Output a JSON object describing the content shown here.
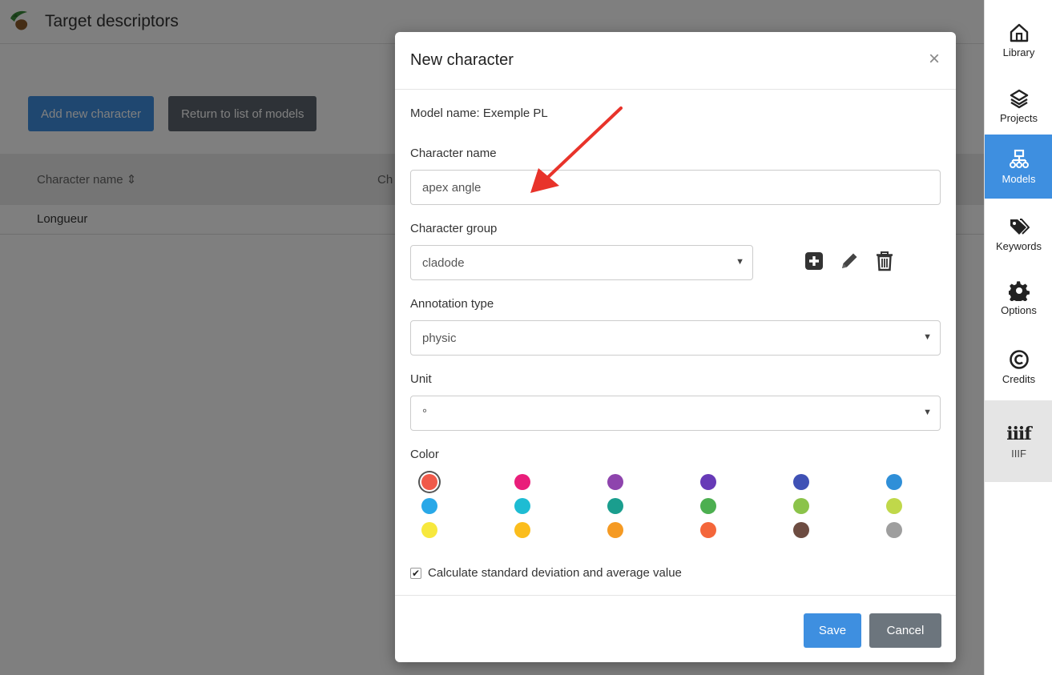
{
  "app": {
    "title": "Target descriptors",
    "add_button": "Add new character",
    "return_button": "Return to list of models",
    "table": {
      "col1": "Character name ⇕",
      "col2": "Ch",
      "rows": [
        "Longueur"
      ]
    }
  },
  "sidebar": {
    "items": [
      {
        "label": "Library",
        "icon": "home-icon"
      },
      {
        "label": "Projects",
        "icon": "layers-icon"
      },
      {
        "label": "Models",
        "icon": "sitemap-icon",
        "active": true
      },
      {
        "label": "Keywords",
        "icon": "tags-icon"
      },
      {
        "label": "Options",
        "icon": "gear-icon"
      },
      {
        "label": "Credits",
        "icon": "copyright-icon"
      },
      {
        "label": "IIIF",
        "icon": "iiif-icon",
        "logo_text": "iiif"
      }
    ]
  },
  "modal": {
    "title": "New character",
    "close": "×",
    "model_name": "Model name: Exemple PL",
    "character_name_label": "Character name",
    "character_name_value": "apex angle",
    "character_group_label": "Character group",
    "character_group_value": "cladode",
    "annotation_type_label": "Annotation type",
    "annotation_type_value": "physic",
    "unit_label": "Unit",
    "unit_value": "°",
    "color_label": "Color",
    "colors": [
      "#f05a4a",
      "#e91e7a",
      "#8e44ad",
      "#673ab7",
      "#3f51b5",
      "#2f8fd8",
      "#29a8e8",
      "#1ebcd3",
      "#1a9e8e",
      "#4caf50",
      "#8bc34a",
      "#c0d84a",
      "#f7e83d",
      "#fbbd1c",
      "#f59a23",
      "#f4663a",
      "#6d4c41",
      "#9e9e9e"
    ],
    "selected_color": "#f05a4a",
    "checkbox_label": "Calculate standard deviation and average value",
    "checkbox_checked": "✔",
    "save": "Save",
    "cancel": "Cancel"
  },
  "accent": "#3e8fe0",
  "arrow_color": "#e8332a"
}
